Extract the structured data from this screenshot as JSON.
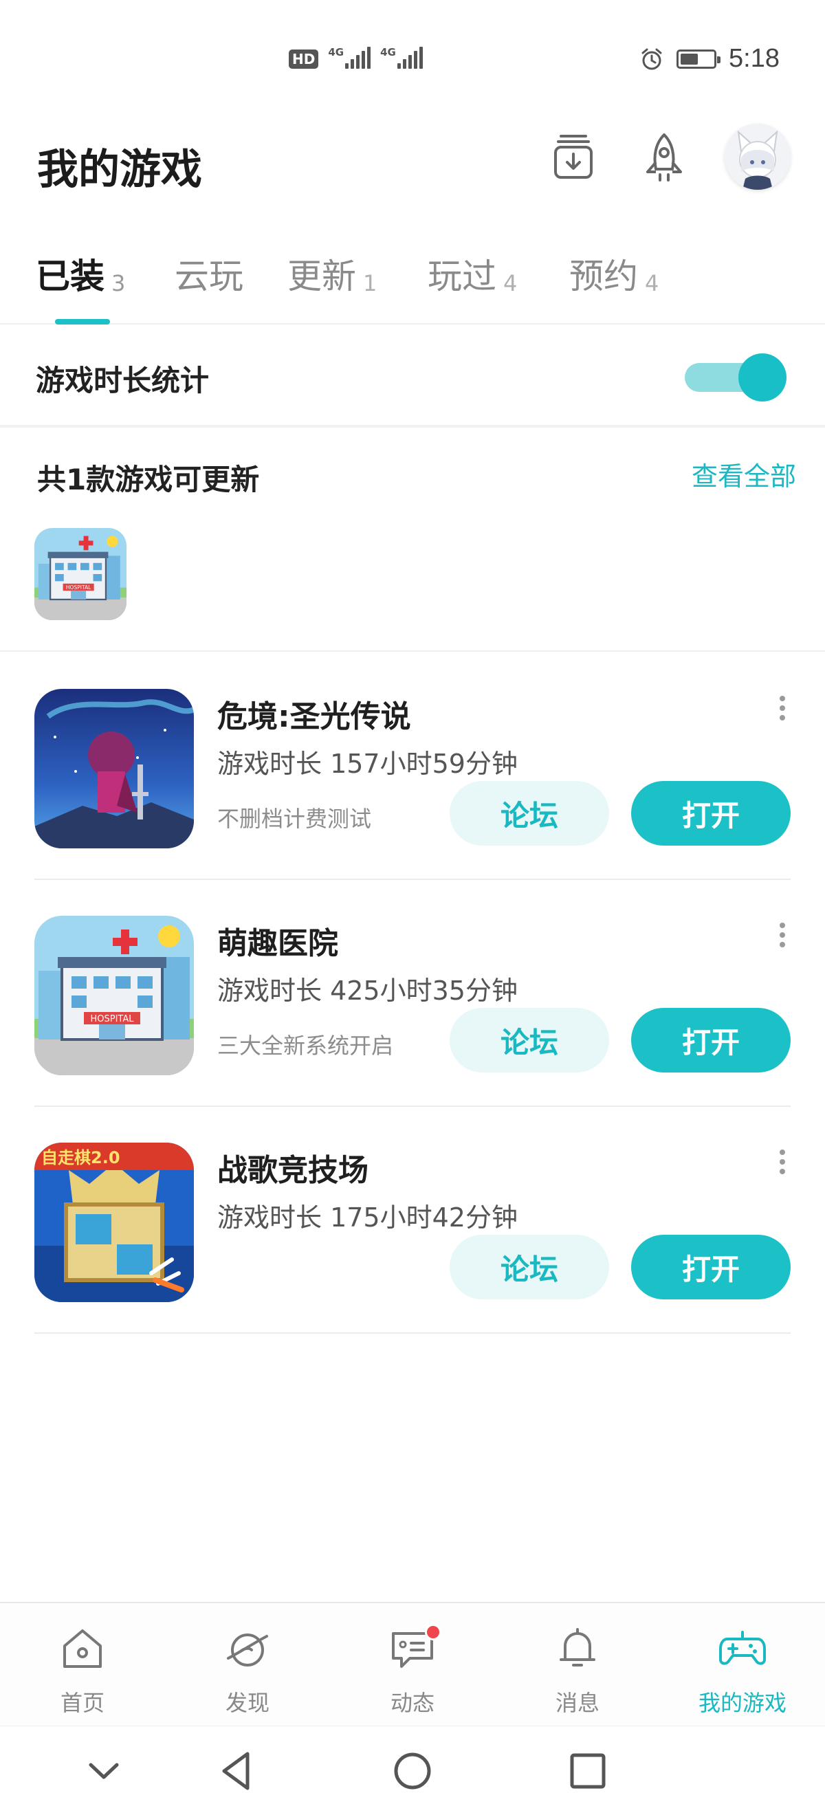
{
  "status_bar": {
    "hd_badge": "HD",
    "network_1": "4G",
    "network_2": "4G",
    "time": "5:18",
    "battery_level": 0.55,
    "icons": [
      "alarm-icon",
      "battery-icon",
      "signal-icon"
    ]
  },
  "header": {
    "title": "我的游戏",
    "actions": [
      "download-manager-icon",
      "rocket-icon",
      "avatar"
    ]
  },
  "tabs": [
    {
      "label": "已装",
      "count": "3",
      "active": true
    },
    {
      "label": "云玩",
      "count": "",
      "active": false
    },
    {
      "label": "更新",
      "count": "1",
      "active": false
    },
    {
      "label": "玩过",
      "count": "4",
      "active": false
    },
    {
      "label": "预约",
      "count": "4",
      "active": false
    }
  ],
  "stats": {
    "label": "游戏时长统计",
    "toggle_on": true
  },
  "updates": {
    "title": "共1款游戏可更新",
    "view_all": "查看全部"
  },
  "games": [
    {
      "name": "危境:圣光传说",
      "playtime": "游戏时长 157小时59分钟",
      "note": "不删档计费测试",
      "forum": "论坛",
      "open": "打开"
    },
    {
      "name": "萌趣医院",
      "playtime": "游戏时长 425小时35分钟",
      "note": "三大全新系统开启",
      "forum": "论坛",
      "open": "打开"
    },
    {
      "name": "战歌竞技场",
      "playtime": "游戏时长 175小时42分钟",
      "note": "",
      "forum": "论坛",
      "open": "打开"
    }
  ],
  "bottom_nav": [
    {
      "label": "首页",
      "icon": "home-icon",
      "active": false
    },
    {
      "label": "发现",
      "icon": "discover-planet-icon",
      "active": false
    },
    {
      "label": "动态",
      "icon": "feed-chat-icon",
      "active": false,
      "badge": true
    },
    {
      "label": "消息",
      "icon": "bell-icon",
      "active": false
    },
    {
      "label": "我的游戏",
      "icon": "gamepad-icon",
      "active": true
    }
  ],
  "colors": {
    "accent": "#1cc0c7",
    "accent_light": "#e8f8f9",
    "badge_red": "#f0454a"
  }
}
